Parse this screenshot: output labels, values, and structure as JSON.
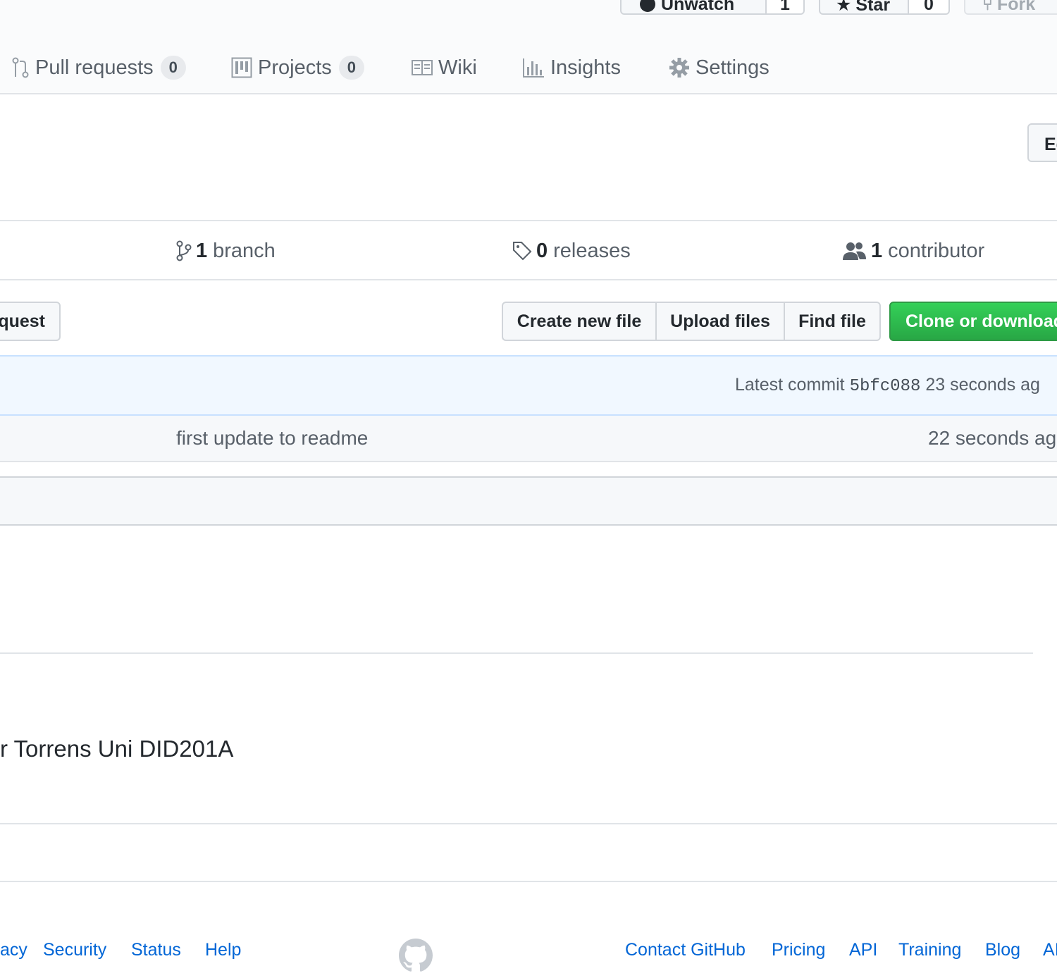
{
  "header": {
    "watch": {
      "label": "Unwatch",
      "count": "1"
    },
    "star": {
      "label": "Star",
      "count": "0"
    },
    "fork": {
      "label": "Fork"
    }
  },
  "tabs": [
    {
      "label": "Pull requests",
      "counter": "0",
      "icon": "pull-request-icon"
    },
    {
      "label": "Projects",
      "counter": "0",
      "icon": "project-icon"
    },
    {
      "label": "Wiki",
      "icon": "book-icon"
    },
    {
      "label": "Insights",
      "icon": "graph-icon"
    },
    {
      "label": "Settings",
      "icon": "gear-icon"
    }
  ],
  "edit_button": "Ed",
  "summary": {
    "branches": {
      "count": "1",
      "label": "branch"
    },
    "releases": {
      "count": "0",
      "label": "releases"
    },
    "contributors": {
      "count": "1",
      "label": "contributor"
    }
  },
  "toolbar": {
    "pull_request": "quest",
    "create_new_file": "Create new file",
    "upload_files": "Upload files",
    "find_file": "Find file",
    "clone_or_download": "Clone or download"
  },
  "commit": {
    "prefix": "Latest commit",
    "sha": "5bfc088",
    "age": "23 seconds ag"
  },
  "files": [
    {
      "message": "first update to readme",
      "age": "22 seconds ag"
    }
  ],
  "readme": {
    "text": "r Torrens Uni DID201A"
  },
  "footer": {
    "left_links": [
      "acy",
      "Security",
      "Status",
      "Help"
    ],
    "right_links": [
      "Contact GitHub",
      "Pricing",
      "API",
      "Training",
      "Blog",
      "AI"
    ]
  },
  "colors": {
    "link": "#0366d6",
    "primary_button": "#28a745",
    "commit_bar": "#f1f8ff"
  }
}
